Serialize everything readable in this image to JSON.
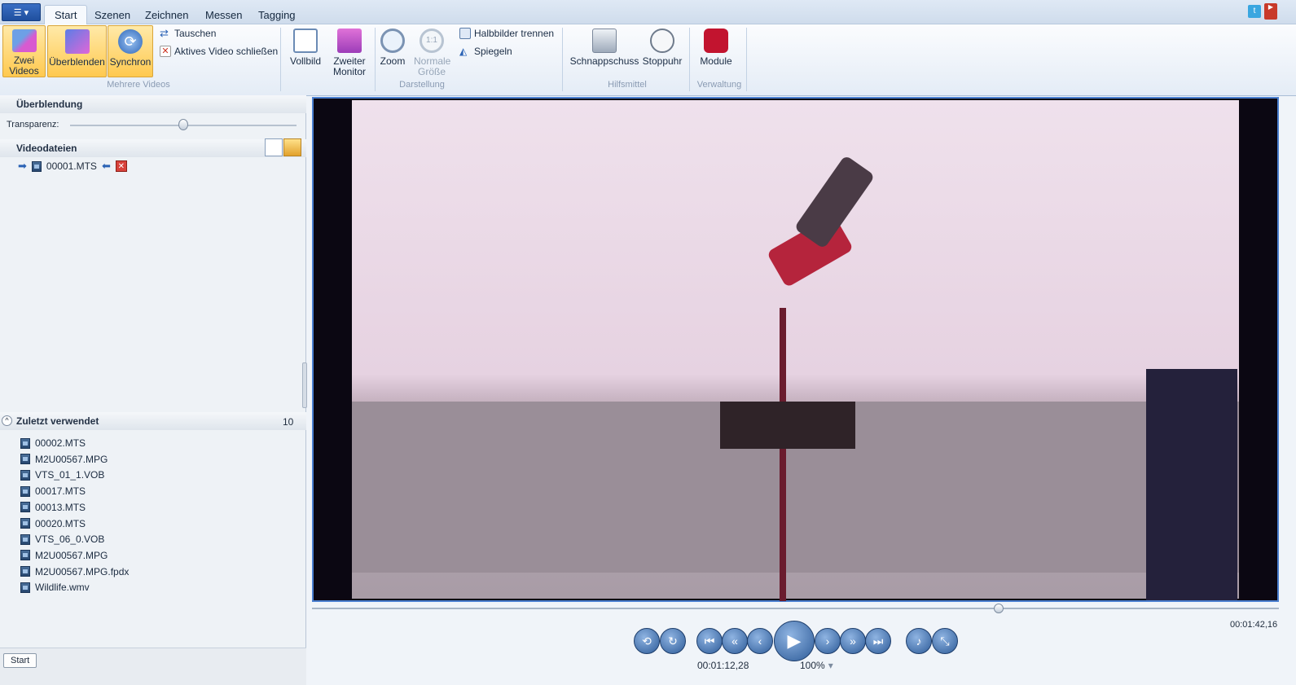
{
  "tabs": [
    "Start",
    "Szenen",
    "Zeichnen",
    "Messen",
    "Tagging"
  ],
  "ribbon": {
    "zwei_videos": "Zwei Videos",
    "ueberblenden": "Überblenden",
    "synchron": "Synchron",
    "tauschen": "Tauschen",
    "aktives_video": "Aktives Video schließen",
    "group_mehrere": "Mehrere Videos",
    "vollbild": "Vollbild",
    "zweiter_monitor": "Zweiter Monitor",
    "zoom": "Zoom",
    "normale_groesse": "Normale Größe",
    "halbbilder": "Halbbilder trennen",
    "spiegeln": "Spiegeln",
    "group_darstellung": "Darstellung",
    "schnappschuss": "Schnappschuss",
    "stoppuhr": "Stoppuhr",
    "group_hilfsmittel": "Hilfsmittel",
    "module": "Module",
    "group_verwaltung": "Verwaltung"
  },
  "left": {
    "ueberblendung": "Überblendung",
    "transparenz": "Transparenz:",
    "transparency_level": 0.5,
    "videodateien": "Videodateien",
    "current_file": "00001.MTS",
    "zuletzt": "Zuletzt verwendet",
    "zuletzt_count": "10",
    "recent": [
      "00002.MTS",
      "M2U00567.MPG",
      "VTS_01_1.VOB",
      "00017.MTS",
      "00013.MTS",
      "00020.MTS",
      "VTS_06_0.VOB",
      "M2U00567.MPG",
      "M2U00567.MPG.fpdx",
      "Wildlife.wmv"
    ],
    "start": "Start"
  },
  "player": {
    "total_time": "00:01:42,16",
    "current_time": "00:01:12,28",
    "zoom": "100%",
    "progress": 0.71
  }
}
